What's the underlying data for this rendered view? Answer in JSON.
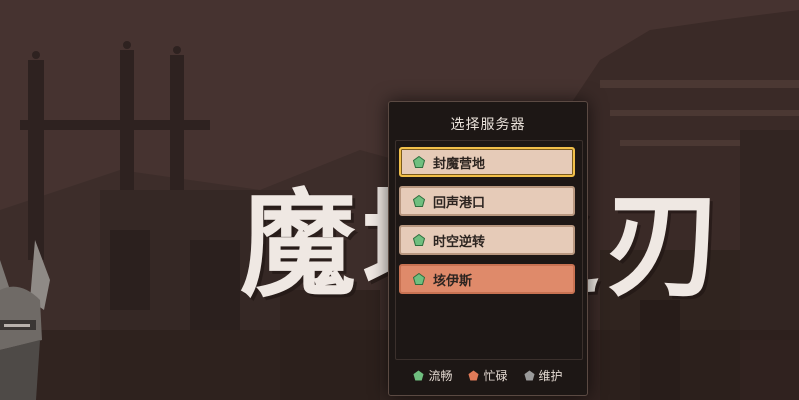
{
  "title_art": "魔域之刃",
  "panel": {
    "title": "选择服务器",
    "servers": [
      {
        "name": "封魔营地",
        "status": "流畅",
        "selected": true
      },
      {
        "name": "回声港口",
        "status": "流畅",
        "selected": false
      },
      {
        "name": "时空逆转",
        "status": "流畅",
        "selected": false
      },
      {
        "name": "垓伊斯",
        "status": "流畅",
        "selected": false
      }
    ],
    "legend": [
      {
        "label": "流畅",
        "color": "#6fbf7f"
      },
      {
        "label": "忙碌",
        "color": "#e07a58"
      },
      {
        "label": "维护",
        "color": "#9a9a9a"
      }
    ]
  },
  "colors": {
    "server_bg": "#e6cbb8",
    "server_highlight_bg": "#df8a6a",
    "selected_border": "#f2c04a",
    "panel_bg": "#1d1715"
  },
  "icons": {
    "status": "pentagon-gem-icon",
    "character": "armored-character-icon"
  }
}
